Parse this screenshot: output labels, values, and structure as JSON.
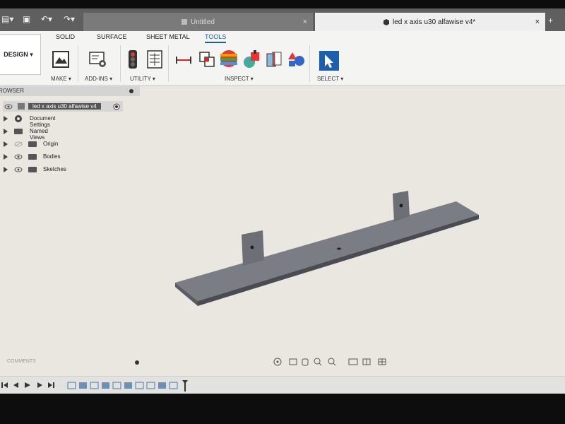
{
  "tabs": {
    "untitled_label": "Untitled",
    "active_label": "led x axis u30 alfawise v4*",
    "close_glyph": "×",
    "plus_glyph": "+"
  },
  "toolbar": {
    "workspace_label": "DESIGN ▾",
    "tabs": [
      "SOLID",
      "SURFACE",
      "SHEET METAL",
      "TOOLS"
    ],
    "groups": {
      "make": "MAKE ▾",
      "addins": "ADD-INS ▾",
      "utility": "UTILITY ▾",
      "inspect": "INSPECT ▾",
      "select": "SELECT ▾"
    }
  },
  "browser": {
    "title": "ROWSER",
    "root": "led x axis u30 alfawise v4",
    "items": [
      "Document Settings",
      "Named Views",
      "Origin",
      "Bodies",
      "Sketches"
    ]
  },
  "comments": {
    "label": "COMMENTS"
  },
  "colors": {
    "accent": "#1b5fb0",
    "part": "#70737a"
  }
}
